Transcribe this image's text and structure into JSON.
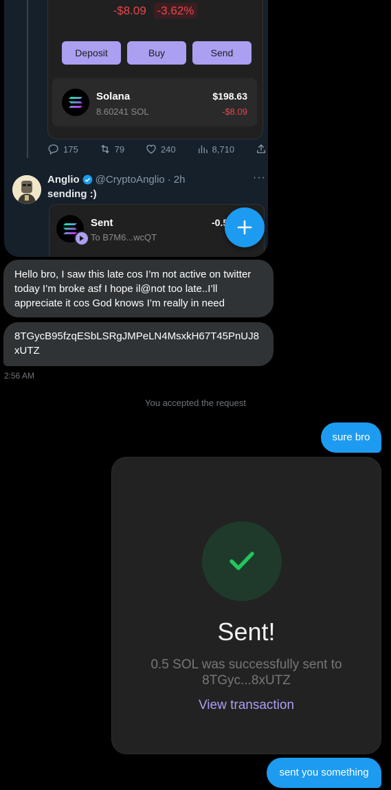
{
  "tweet": {
    "wallet": {
      "change_amount": "-$8.09",
      "change_percent": "-3.62%",
      "buttons": [
        "Deposit",
        "Buy",
        "Send"
      ],
      "token": {
        "name": "Solana",
        "amount": "8.60241 SOL",
        "usd_value": "$198.63",
        "usd_change": "-$8.09"
      }
    },
    "engagement": {
      "replies": "175",
      "retweets": "79",
      "likes": "240",
      "views": "8,710"
    },
    "reply": {
      "name": "Anglio",
      "handle": "@CryptoAnglio",
      "time": "2h",
      "text": "sending :)",
      "embed_title": "Sent",
      "embed_to": "To B7M6...wcQT",
      "embed_amount": "-0.5"
    }
  },
  "messages": {
    "incoming_1": "Hello bro, I saw this late cos I’m not active on twitter today I’m broke asf I hope il@not too late..I’ll appreciate it cos God knows I’m really in need",
    "incoming_2": "8TGycB95fzqESbLSRgJMPeLN4MsxkH67T45PnUJ8xUTZ",
    "timestamp": "2:56 AM",
    "system": "You accepted the request",
    "outgoing_1": "sure bro",
    "outgoing_2": "sent you something"
  },
  "sent_card": {
    "title": "Sent!",
    "description": "0.5 SOL was successfully sent to 8TGyc...8xUTZ",
    "link": "View transaction"
  },
  "colors": {
    "accent_blue": "#1d9bf0",
    "phantom_purple": "#ab9ff2",
    "loss_red": "#e5484d",
    "success_green": "#22c55e"
  }
}
